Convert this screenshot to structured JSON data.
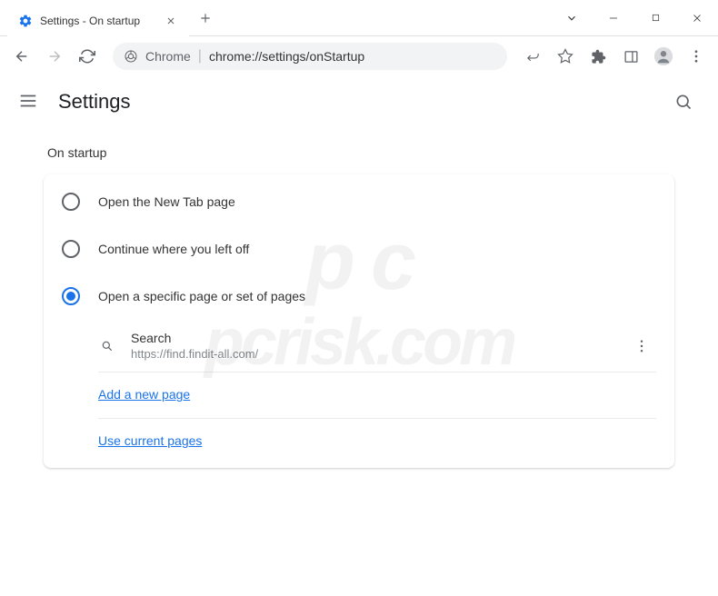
{
  "window": {
    "tab_title": "Settings - On startup"
  },
  "omnibox": {
    "prefix": "Chrome",
    "url": "chrome://settings/onStartup"
  },
  "header": {
    "title": "Settings"
  },
  "section": {
    "title": "On startup",
    "options": [
      {
        "label": "Open the New Tab page",
        "selected": false
      },
      {
        "label": "Continue where you left off",
        "selected": false
      },
      {
        "label": "Open a specific page or set of pages",
        "selected": true
      }
    ],
    "pages": [
      {
        "name": "Search",
        "url": "https://find.findit-all.com/"
      }
    ],
    "links": {
      "add": "Add a new page",
      "use_current": "Use current pages"
    }
  },
  "watermark": "pcrisk.com"
}
